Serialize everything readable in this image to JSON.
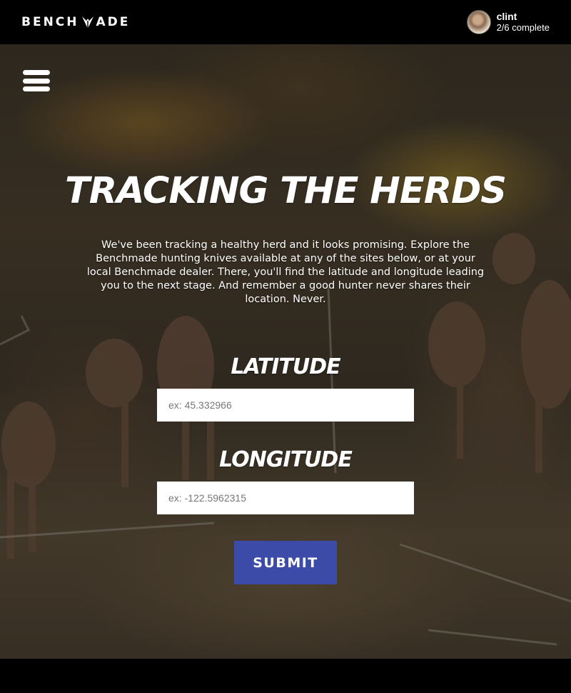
{
  "header": {
    "logo_text_left": "BENCH",
    "logo_text_right": "ADE",
    "logo_icon": "butterfly-logo-icon",
    "user": {
      "name": "clint",
      "progress": "2/6 complete"
    }
  },
  "menu_icon": "hamburger-menu-icon",
  "main": {
    "title": "TRACKING THE HERDS",
    "intro": "We've been tracking a healthy herd and it looks promising. Explore the Benchmade hunting knives available at any of the sites below, or at your local Benchmade dealer. There, you'll find the latitude and longitude leading you to the next stage. And remember a good hunter never shares their location. Never.",
    "latitude": {
      "label": "LATITUDE",
      "value": "",
      "placeholder": "ex: 45.332966"
    },
    "longitude": {
      "label": "LONGITUDE",
      "value": "",
      "placeholder": "ex: -122.5962315"
    },
    "submit_label": "SUBMIT"
  },
  "colors": {
    "topbar": "#000000",
    "submit_button": "#3c4ba8",
    "text": "#ffffff"
  }
}
